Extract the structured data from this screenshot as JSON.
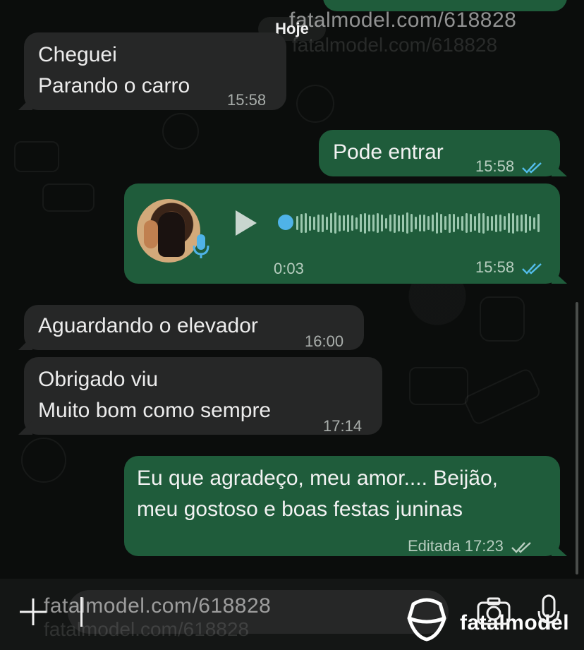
{
  "date_divider": "Hoje",
  "watermark": {
    "url": "fatalmodel.com/618828",
    "url_ghost": "fatalmodel.com/618828",
    "brand": "fatalmodel"
  },
  "messages": [
    {
      "direction": "in",
      "lines": [
        "Cheguei",
        "Parando o carro"
      ],
      "time": "15:58"
    },
    {
      "direction": "out",
      "lines": [
        "Pode entrar"
      ],
      "time": "15:58",
      "status": "read"
    },
    {
      "direction": "out",
      "type": "voice",
      "duration": "0:03",
      "time": "15:58",
      "status": "read"
    },
    {
      "direction": "in",
      "lines": [
        "Aguardando o elevador"
      ],
      "time": "16:00"
    },
    {
      "direction": "in",
      "lines": [
        "Obrigado viu",
        "Muito bom como sempre"
      ],
      "time": "17:14"
    },
    {
      "direction": "out",
      "lines": [
        "Eu que agradeço, meu amor....  Beijão,",
        "meu gostoso e boas festas juninas"
      ],
      "edited_label": "Editada",
      "time": "17:23",
      "status": "delivered"
    }
  ],
  "composer": {
    "value": "",
    "icons": [
      "plus-icon",
      "sticker-icon",
      "camera-icon",
      "microphone-icon"
    ]
  },
  "colors": {
    "incoming_bubble": "#262727",
    "outgoing_bubble": "#1f5c3b",
    "read_ticks": "#53bdeb",
    "delivered_ticks": "#b7cdbf",
    "background": "#0b0d0c"
  }
}
